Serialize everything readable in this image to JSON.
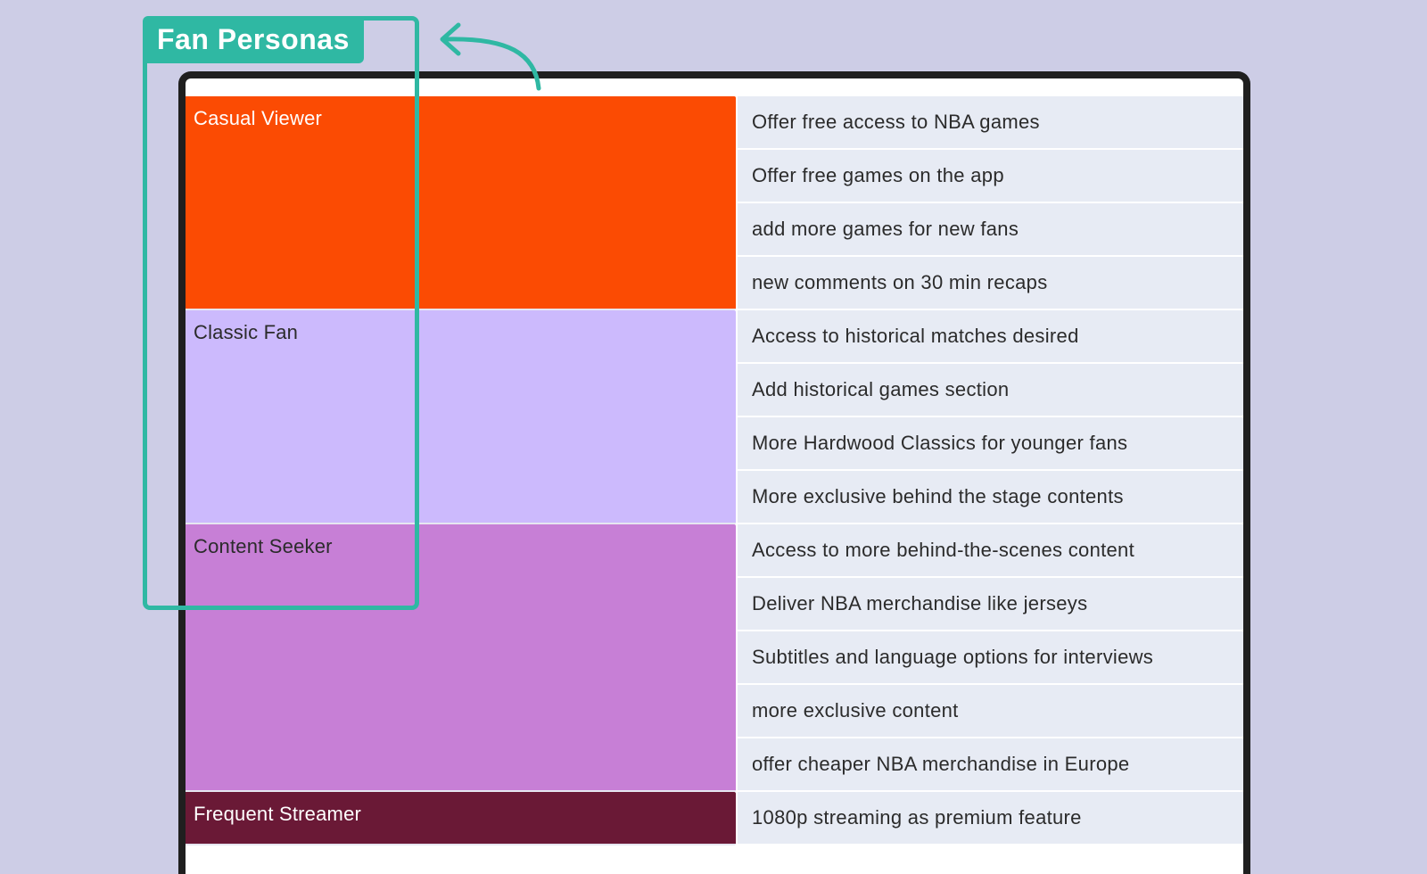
{
  "annotation": {
    "label": "Fan Personas",
    "color": "#2fb8a3"
  },
  "board": {
    "groups": [
      {
        "persona": "Casual Viewer",
        "color": "#fb4b03",
        "text_color": "#ffffff",
        "items": [
          "Offer free access to NBA games",
          "Offer free games on the app",
          "add more games for new fans",
          "new comments on 30 min recaps"
        ]
      },
      {
        "persona": "Classic Fan",
        "color": "#ccbafd",
        "text_color": "#2b2b2b",
        "items": [
          "Access to historical matches desired",
          "Add historical games section",
          "More Hardwood Classics for younger fans",
          "More exclusive behind the stage contents"
        ]
      },
      {
        "persona": "Content Seeker",
        "color": "#c77fd6",
        "text_color": "#2b2b2b",
        "items": [
          "Access to more behind-the-scenes content",
          "Deliver NBA merchandise like jerseys",
          "Subtitles and language options for interviews",
          "more exclusive content",
          "offer cheaper NBA merchandise in Europe"
        ]
      },
      {
        "persona": "Frequent Streamer",
        "color": "#6a1936",
        "text_color": "#ffffff",
        "items": [
          "1080p streaming as premium feature"
        ]
      }
    ]
  }
}
